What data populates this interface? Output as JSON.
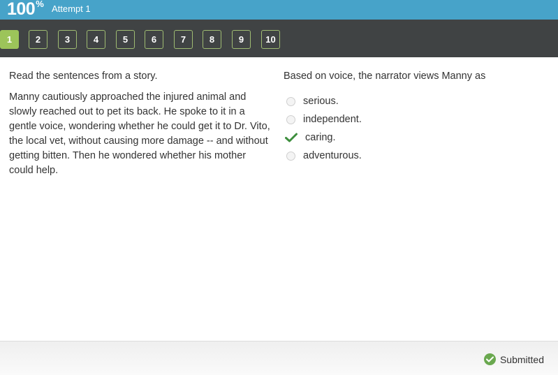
{
  "header": {
    "score_value": "100",
    "score_unit": "%",
    "attempt_label": "Attempt 1"
  },
  "nav": {
    "questions": [
      {
        "label": "1",
        "active": true
      },
      {
        "label": "2",
        "active": false
      },
      {
        "label": "3",
        "active": false
      },
      {
        "label": "4",
        "active": false
      },
      {
        "label": "5",
        "active": false
      },
      {
        "label": "6",
        "active": false
      },
      {
        "label": "7",
        "active": false
      },
      {
        "label": "8",
        "active": false
      },
      {
        "label": "9",
        "active": false
      },
      {
        "label": "10",
        "active": false
      }
    ]
  },
  "passage": {
    "instruction": "Read the sentences from a story.",
    "text": "Manny cautiously approached the injured animal and slowly reached out to pet its back. He spoke to it in a gentle voice, wondering whether he could get it to Dr. Vito, the local vet, without causing more damage -- and without getting bitten. Then he wondered whether his mother could help."
  },
  "question": {
    "prompt": "Based on voice, the narrator views Manny as",
    "options": [
      {
        "label": "serious.",
        "selected": false
      },
      {
        "label": "independent.",
        "selected": false
      },
      {
        "label": "caring.",
        "selected": true
      },
      {
        "label": "adventurous.",
        "selected": false
      }
    ]
  },
  "footer": {
    "status_label": "Submitted"
  },
  "colors": {
    "header_bg": "#47a3c9",
    "nav_bg": "#404344",
    "active_question": "#9cc45a",
    "check_green": "#3e8e3e",
    "submitted_green": "#6aa84f"
  }
}
